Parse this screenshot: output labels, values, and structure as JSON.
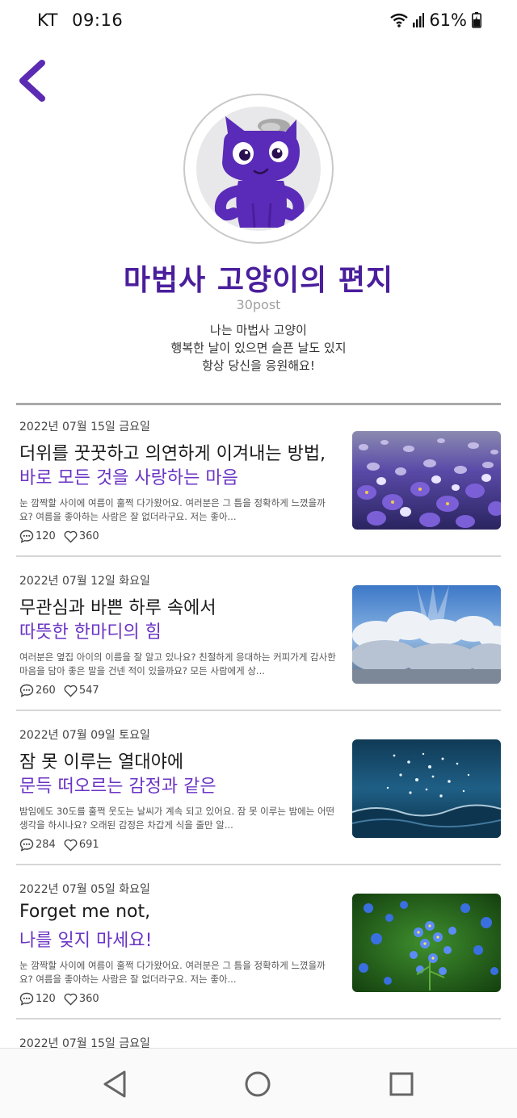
{
  "status": {
    "carrier": "KT",
    "time": "09:16",
    "battery": "61%"
  },
  "header": {
    "back_icon": "chevron-left-icon"
  },
  "profile": {
    "title": "마법사 고양이의 편지",
    "post_count": "30post",
    "bio": [
      "나는 마법사 고양이",
      "행복한 날이 있으면 슬픈 날도 있지",
      "항상 당신을 응원해요!"
    ]
  },
  "colors": {
    "brand": "#4a1e9c",
    "accent": "#6a34c4"
  },
  "posts": [
    {
      "date": "2022년 07월 15일 금요일",
      "title_line1": "더위를 꿋꿋하고 의연하게 이겨내는 방법,",
      "title_line2": "바로 모든 것을  사랑하는 마음",
      "excerpt": "눈 깜짝할 사이에 여름이 훌쩍 다가왔어요. 여러분은 그 틈을 정확하게 느꼈을까요? 여름을 좋아하는 사람은 잘 없더라구요. 저는 좋아...",
      "comments": "120",
      "likes": "360",
      "image": "crocus-field"
    },
    {
      "date": "2022년 07월 12일 화요일",
      "title_line1": "무관심과 바쁜 하루 속에서",
      "title_line2": "따뜻한 한마디의 힘",
      "excerpt": "여러분은 옆집 아이의 이름을 잘 알고 있나요? 친절하게 응대하는 커피가게 감사한 마음을 담아 좋은 말을 건넨 적이 있을까요? 모든 사람에게 상...",
      "comments": "260",
      "likes": "547",
      "image": "clouds-sky"
    },
    {
      "date": "2022년 07월 09일 토요일",
      "title_line1": "잠 못 이루는 열대야에",
      "title_line2": "문득 떠오르는 감정과 같은",
      "excerpt": "밤임에도 30도를 훌쩍 웃도는 날씨가 계속 되고 있어요. 잠 못 이루는 밤에는 어떤 생각을 하시나요? 오래된 감정은 차갑게 식을 줄만 알...",
      "comments": "284",
      "likes": "691",
      "image": "sea-sparkle"
    },
    {
      "date": "2022년 07월 05일 화요일",
      "title_line1": "Forget me not,",
      "title_line2": "나를 잊지 마세요!",
      "excerpt": "눈 깜짝할 사이에 여름이 훌쩍 다가왔어요. 여러분은 그 틈을 정확하게 느꼈을까요? 여름을 좋아하는 사람은 잘 없더라구요. 저는 좋아...",
      "comments": "120",
      "likes": "360",
      "image": "forget-me-not"
    },
    {
      "date": "2022년 07월 15일 금요일"
    }
  ],
  "nav": {
    "back": "triangle-back-icon",
    "home": "circle-home-icon",
    "recent": "square-recents-icon"
  }
}
